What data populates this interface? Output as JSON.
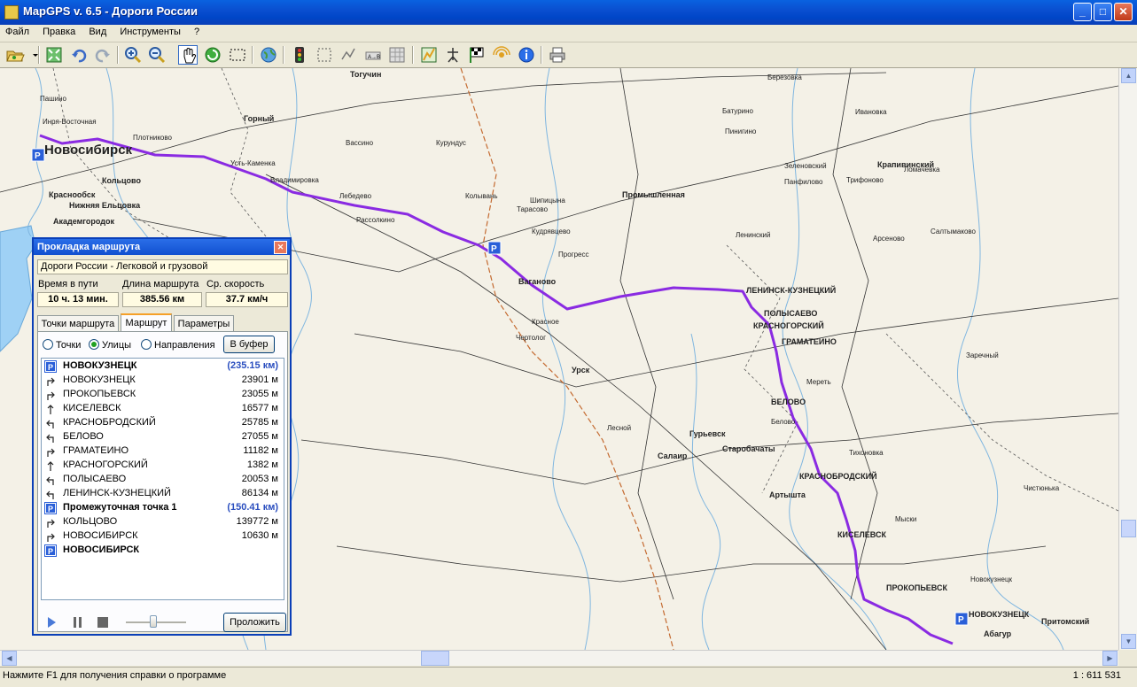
{
  "window": {
    "title": "MapGPS v. 6.5 - Дороги России",
    "minimize": "_",
    "maximize": "□",
    "close": "✕"
  },
  "menu": [
    "Файл",
    "Правка",
    "Вид",
    "Инструменты",
    "?"
  ],
  "toolbar_icons": [
    "open-icon",
    "dropdown-icon",
    "fit-map-icon",
    "undo-icon",
    "redo-icon",
    "zoom-in-icon",
    "zoom-out-icon",
    "hand-icon",
    "refresh-icon",
    "select-rect-icon",
    "globe-icon",
    "traffic-light-icon",
    "select-icon",
    "points-icon",
    "route-ab-icon",
    "table-icon",
    "stats-icon",
    "antenna-icon",
    "finish-flags-icon",
    "satellite-icon",
    "info-icon",
    "print-icon"
  ],
  "colors": {
    "route": "#8a2be2",
    "water": "#9fd1f5",
    "title_bar": "#0a4fd0",
    "panel_border": "#0a3fb8"
  },
  "map": {
    "major_cities": [
      {
        "name": "Новосибирск"
      },
      {
        "name": "НОВОКУЗНЕЦК"
      },
      {
        "name": "ЛЕНИНСК-КУЗНЕЦКИЙ"
      },
      {
        "name": "КРАСНОБРОДСКИЙ"
      },
      {
        "name": "КИСЕЛЕВСК"
      },
      {
        "name": "ПРОКОПЬЕВСК"
      },
      {
        "name": "БЕЛОВО"
      },
      {
        "name": "ПОЛЫСАЕВО"
      },
      {
        "name": "ГРАМАТЕИНО"
      },
      {
        "name": "КРАСНОГОРСКИЙ"
      }
    ],
    "towns": [
      "Пашино",
      "Инря-Восточная",
      "Кольцово",
      "Краснообск",
      "Нижняя Ельцовка",
      "Академгородок",
      "Горный",
      "Тогучин",
      "Усть-Каменка",
      "Владимировка",
      "Лебедево",
      "Рассолкино",
      "Шипицына",
      "Промышленная",
      "Урск",
      "Ваганово",
      "Гурьевск",
      "Салаир",
      "Старобачаты",
      "Артышта",
      "Тихоновка",
      "Крапивинский",
      "Плотниково",
      "Красное",
      "Вассино",
      "Курундус",
      "Колывань",
      "Тарасово",
      "Кудрявцево",
      "Батурино",
      "Березовка",
      "Зеленовский",
      "Трифоново",
      "Пинигино",
      "Ленинский",
      "Белово",
      "Мыски",
      "Ивановка",
      "Чистюнька",
      "Заречный",
      "Салтымаково",
      "Панфилово",
      "Арсеново",
      "Мереть",
      "Прогресс",
      "Чертолог",
      "Ломачевка",
      "Лесной",
      "Новокузнецк",
      "Абагур",
      "Притомский"
    ],
    "scale": "1 : 611 531"
  },
  "route_panel": {
    "title": "Прокладка маршрута",
    "profile": "Дороги России - Легковой и грузовой",
    "labels": {
      "time": "Время в пути",
      "length": "Длина маршрута",
      "speed": "Ср. скорость"
    },
    "values": {
      "time": "10 ч. 13 мин.",
      "length": "385.56  км",
      "speed": "37.7 км/ч"
    },
    "tabs": [
      "Точки маршрута",
      "Маршрут",
      "Параметры"
    ],
    "active_tab": "Маршрут",
    "radios": [
      "Точки",
      "Улицы",
      "Направления"
    ],
    "radio_selected": "Улицы",
    "buffer_button": "В буфер",
    "build_button": "Проложить",
    "slider_level": 0.45,
    "rows": [
      {
        "kind": "header",
        "icon": "parking-icon",
        "name": "НОВОКУЗНЕЦК",
        "dist": "(235.15  км)"
      },
      {
        "kind": "step",
        "icon": "turn-right-icon",
        "name": "НОВОКУЗНЕЦК",
        "dist": "23901 м"
      },
      {
        "kind": "step",
        "icon": "turn-right-icon",
        "name": "ПРОКОПЬЕВСК",
        "dist": "23055 м"
      },
      {
        "kind": "step",
        "icon": "straight-icon",
        "name": "КИСЕЛЕВСК",
        "dist": "16577 м"
      },
      {
        "kind": "step",
        "icon": "turn-left-icon",
        "name": "КРАСНОБРОДСКИЙ",
        "dist": "25785 м"
      },
      {
        "kind": "step",
        "icon": "turn-left-icon",
        "name": "БЕЛОВО",
        "dist": "27055 м"
      },
      {
        "kind": "step",
        "icon": "turn-right-icon",
        "name": "ГРАМАТЕИНО",
        "dist": "11182 м"
      },
      {
        "kind": "step",
        "icon": "straight-icon",
        "name": "КРАСНОГОРСКИЙ",
        "dist": "1382 м"
      },
      {
        "kind": "step",
        "icon": "turn-left-icon",
        "name": "ПОЛЫСАЕВО",
        "dist": "20053 м"
      },
      {
        "kind": "step",
        "icon": "turn-left-icon",
        "name": "ЛЕНИНСК-КУЗНЕЦКИЙ",
        "dist": "86134 м"
      },
      {
        "kind": "header",
        "icon": "parking-icon",
        "name": "Промежуточная точка 1",
        "dist": "(150.41  км)"
      },
      {
        "kind": "step",
        "icon": "turn-right-icon",
        "name": "КОЛЬЦОВО",
        "dist": "139772 м"
      },
      {
        "kind": "step",
        "icon": "turn-right-icon",
        "name": "НОВОСИБИРСК",
        "dist": "10630 м"
      },
      {
        "kind": "header",
        "icon": "parking-icon",
        "name": "НОВОСИБИРСК",
        "dist": ""
      }
    ]
  },
  "status": {
    "text": "Нажмите F1 для получения справки о программе",
    "scale": "1 : 611 531"
  }
}
